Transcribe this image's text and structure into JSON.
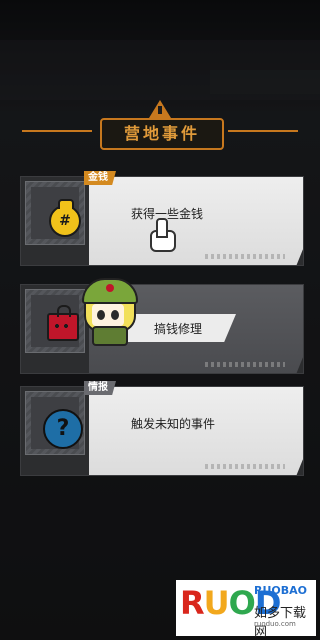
{
  "header": {
    "title": "营地事件"
  },
  "cards": [
    {
      "tag": "金钱",
      "label": "获得一些金钱",
      "icon": "money-bag-icon"
    },
    {
      "tag": "",
      "label": "搞钱修理",
      "icon": "red-toolbox-icon"
    },
    {
      "tag": "情报",
      "label": "触发未知的事件",
      "icon": "question-icon"
    }
  ],
  "watermark": {
    "brand": "RUOBAO",
    "site_cn": "如多下载网",
    "site_url": "ruoduo.com"
  },
  "colors": {
    "accent": "#c7781e",
    "money": "#f1c21a",
    "info": "#1e6ea6"
  }
}
